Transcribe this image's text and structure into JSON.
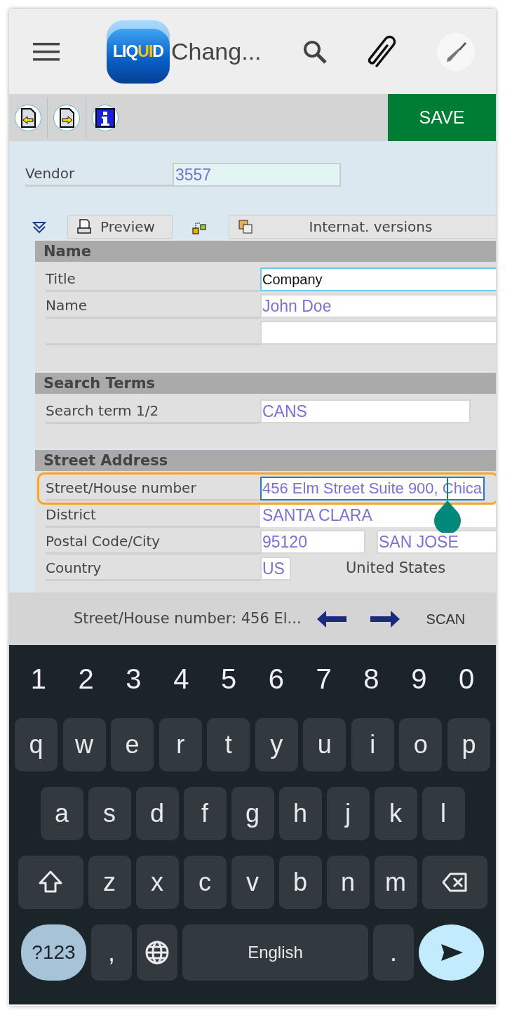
{
  "header": {
    "logo": "LIQUID",
    "title": "Chang..."
  },
  "toolbar": {
    "save": "SAVE"
  },
  "vendor": {
    "label": "Vendor",
    "value": "3557"
  },
  "actions": [
    {
      "kind": "collapse"
    },
    {
      "kind": "button",
      "label": "Preview"
    },
    {
      "kind": "hierarchy"
    },
    {
      "kind": "button",
      "label": "Internat. versions"
    }
  ],
  "sections": [
    {
      "title": "Name",
      "rows": [
        {
          "label": "Title",
          "focused": false,
          "inputs": [
            {
              "kind": "dropdown",
              "value": "Company"
            }
          ]
        },
        {
          "label": "Name",
          "focused": false,
          "inputs": [
            {
              "kind": "text",
              "value": "John Doe"
            }
          ]
        },
        {
          "focused": false,
          "inputs": [
            {
              "kind": "text"
            }
          ]
        }
      ]
    },
    {
      "title": "Search Terms",
      "rows": [
        {
          "label": "Search term 1/2",
          "focused": false,
          "inputs": [
            {
              "kind": "short",
              "value": "CANS"
            }
          ]
        }
      ]
    },
    {
      "title": "Street Address",
      "rows": [
        {
          "label": "Street/House number",
          "focused": true,
          "inputs": [
            {
              "kind": "text",
              "value": "456 Elm Street Suite 900, Chica"
            }
          ]
        },
        {
          "label": "District",
          "focused": false,
          "inputs": [
            {
              "kind": "plain",
              "value": "SANTA CLARA"
            }
          ]
        },
        {
          "label": "Postal Code/City",
          "focused": false,
          "inputs": [
            {
              "kind": "postal",
              "value": "95120"
            },
            {
              "kind": "text",
              "value": "SAN JOSE"
            }
          ]
        },
        {
          "label": "Country",
          "focused": false,
          "inputs": [
            {
              "kind": "tiny",
              "value": "US"
            }
          ],
          "note": "United States"
        }
      ]
    }
  ],
  "status_bar": {
    "text": "Street/House number: 456 El...",
    "action": "SCAN"
  },
  "keyboard": {
    "numbers": [
      "1",
      "2",
      "3",
      "4",
      "5",
      "6",
      "7",
      "8",
      "9",
      "0"
    ],
    "rows": [
      {
        "keys": [
          {
            "kind": "letter",
            "label": "q"
          },
          {
            "kind": "letter",
            "label": "w"
          },
          {
            "kind": "letter",
            "label": "e"
          },
          {
            "kind": "letter",
            "label": "r"
          },
          {
            "kind": "letter",
            "label": "t"
          },
          {
            "kind": "letter",
            "label": "y"
          },
          {
            "kind": "letter",
            "label": "u"
          },
          {
            "kind": "letter",
            "label": "i"
          },
          {
            "kind": "letter",
            "label": "o"
          },
          {
            "kind": "letter",
            "label": "p"
          }
        ]
      },
      {
        "keys": [
          {
            "kind": "letter",
            "label": "a"
          },
          {
            "kind": "letter",
            "label": "s"
          },
          {
            "kind": "letter",
            "label": "d"
          },
          {
            "kind": "letter",
            "label": "f"
          },
          {
            "kind": "letter",
            "label": "g"
          },
          {
            "kind": "letter",
            "label": "h"
          },
          {
            "kind": "letter",
            "label": "j"
          },
          {
            "kind": "letter",
            "label": "k"
          },
          {
            "kind": "letter",
            "label": "l"
          }
        ]
      },
      {
        "keys": [
          {
            "kind": "shift"
          },
          {
            "kind": "letter",
            "label": "z"
          },
          {
            "kind": "letter",
            "label": "x"
          },
          {
            "kind": "letter",
            "label": "c"
          },
          {
            "kind": "letter",
            "label": "v"
          },
          {
            "kind": "letter",
            "label": "b"
          },
          {
            "kind": "letter",
            "label": "n"
          },
          {
            "kind": "letter",
            "label": "m"
          },
          {
            "kind": "backspace"
          }
        ]
      },
      {
        "keys": [
          {
            "kind": "symbols",
            "label": "?123"
          },
          {
            "kind": "letter",
            "label": ","
          },
          {
            "kind": "globe"
          },
          {
            "kind": "space",
            "label": "English"
          },
          {
            "kind": "letter",
            "label": "."
          },
          {
            "kind": "send"
          }
        ]
      }
    ]
  }
}
